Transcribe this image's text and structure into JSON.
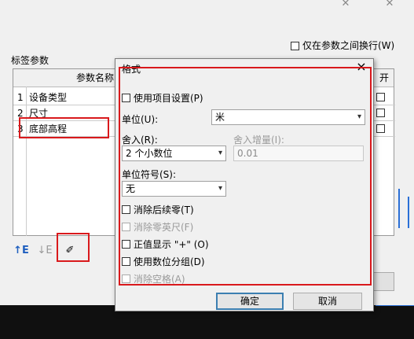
{
  "background_dialog": {
    "only_between_params_label": "仅在参数之间换行(W)",
    "group_title": "标签参数",
    "grid_header_name": "参数名称",
    "grid_header_right": "开",
    "rows": [
      {
        "num": "1",
        "name": "设备类型"
      },
      {
        "num": "2",
        "name": "尺寸"
      },
      {
        "num": "3",
        "name": "底部高程"
      }
    ],
    "tools": {
      "move_up": "↑E",
      "move_down": "↓E",
      "format": "✐"
    }
  },
  "format_dialog": {
    "title": "格式",
    "close": "×",
    "use_project_settings": "使用项目设置(P)",
    "units_label": "单位(U):",
    "units_value": "米",
    "rounding_label": "舍入(R):",
    "rounding_value": "2 个小数位",
    "rounding_increment_label": "舍入增量(I):",
    "rounding_increment_value": "0.01",
    "unit_symbol_label": "单位符号(S):",
    "unit_symbol_value": "无",
    "suppress_trailing_zeros": "消除后续零(T)",
    "suppress_zero_feet": "消除零英尺(F)",
    "show_plus_sign": "正值显示 \"+\" (O)",
    "digit_grouping": "使用数位分组(D)",
    "suppress_spaces": "消除空格(A)",
    "ok": "确定",
    "cancel": "取消"
  },
  "colors": {
    "highlight": "#d9191c",
    "accent": "#2a6fd6"
  }
}
